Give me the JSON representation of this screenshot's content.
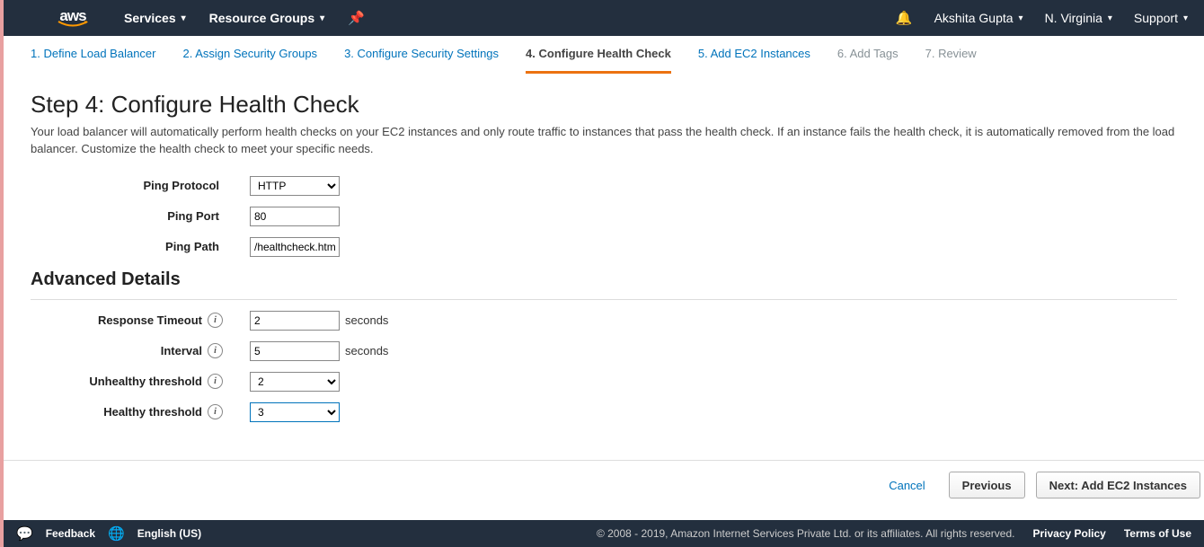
{
  "header": {
    "services": "Services",
    "resource_groups": "Resource Groups",
    "user": "Akshita Gupta",
    "region": "N. Virginia",
    "support": "Support"
  },
  "tabs": [
    {
      "label": "1. Define Load Balancer",
      "state": "link"
    },
    {
      "label": "2. Assign Security Groups",
      "state": "link"
    },
    {
      "label": "3. Configure Security Settings",
      "state": "link"
    },
    {
      "label": "4. Configure Health Check",
      "state": "active"
    },
    {
      "label": "5. Add EC2 Instances",
      "state": "link"
    },
    {
      "label": "6. Add Tags",
      "state": "disabled"
    },
    {
      "label": "7. Review",
      "state": "disabled"
    }
  ],
  "page": {
    "title": "Step 4: Configure Health Check",
    "desc": "Your load balancer will automatically perform health checks on your EC2 instances and only route traffic to instances that pass the health check. If an instance fails the health check, it is automatically removed from the load balancer. Customize the health check to meet your specific needs."
  },
  "form": {
    "ping_protocol_label": "Ping Protocol",
    "ping_protocol_value": "HTTP",
    "ping_port_label": "Ping Port",
    "ping_port_value": "80",
    "ping_path_label": "Ping Path",
    "ping_path_value": "/healthcheck.html",
    "advanced_title": "Advanced Details",
    "response_timeout_label": "Response Timeout",
    "response_timeout_value": "2",
    "interval_label": "Interval",
    "interval_value": "5",
    "unhealthy_label": "Unhealthy threshold",
    "unhealthy_value": "2",
    "healthy_label": "Healthy threshold",
    "healthy_value": "3",
    "seconds": "seconds"
  },
  "buttons": {
    "cancel": "Cancel",
    "previous": "Previous",
    "next": "Next: Add EC2 Instances"
  },
  "footer": {
    "feedback": "Feedback",
    "language": "English (US)",
    "copyright": "© 2008 - 2019, Amazon Internet Services Private Ltd. or its affiliates. All rights reserved.",
    "privacy": "Privacy Policy",
    "terms": "Terms of Use"
  }
}
